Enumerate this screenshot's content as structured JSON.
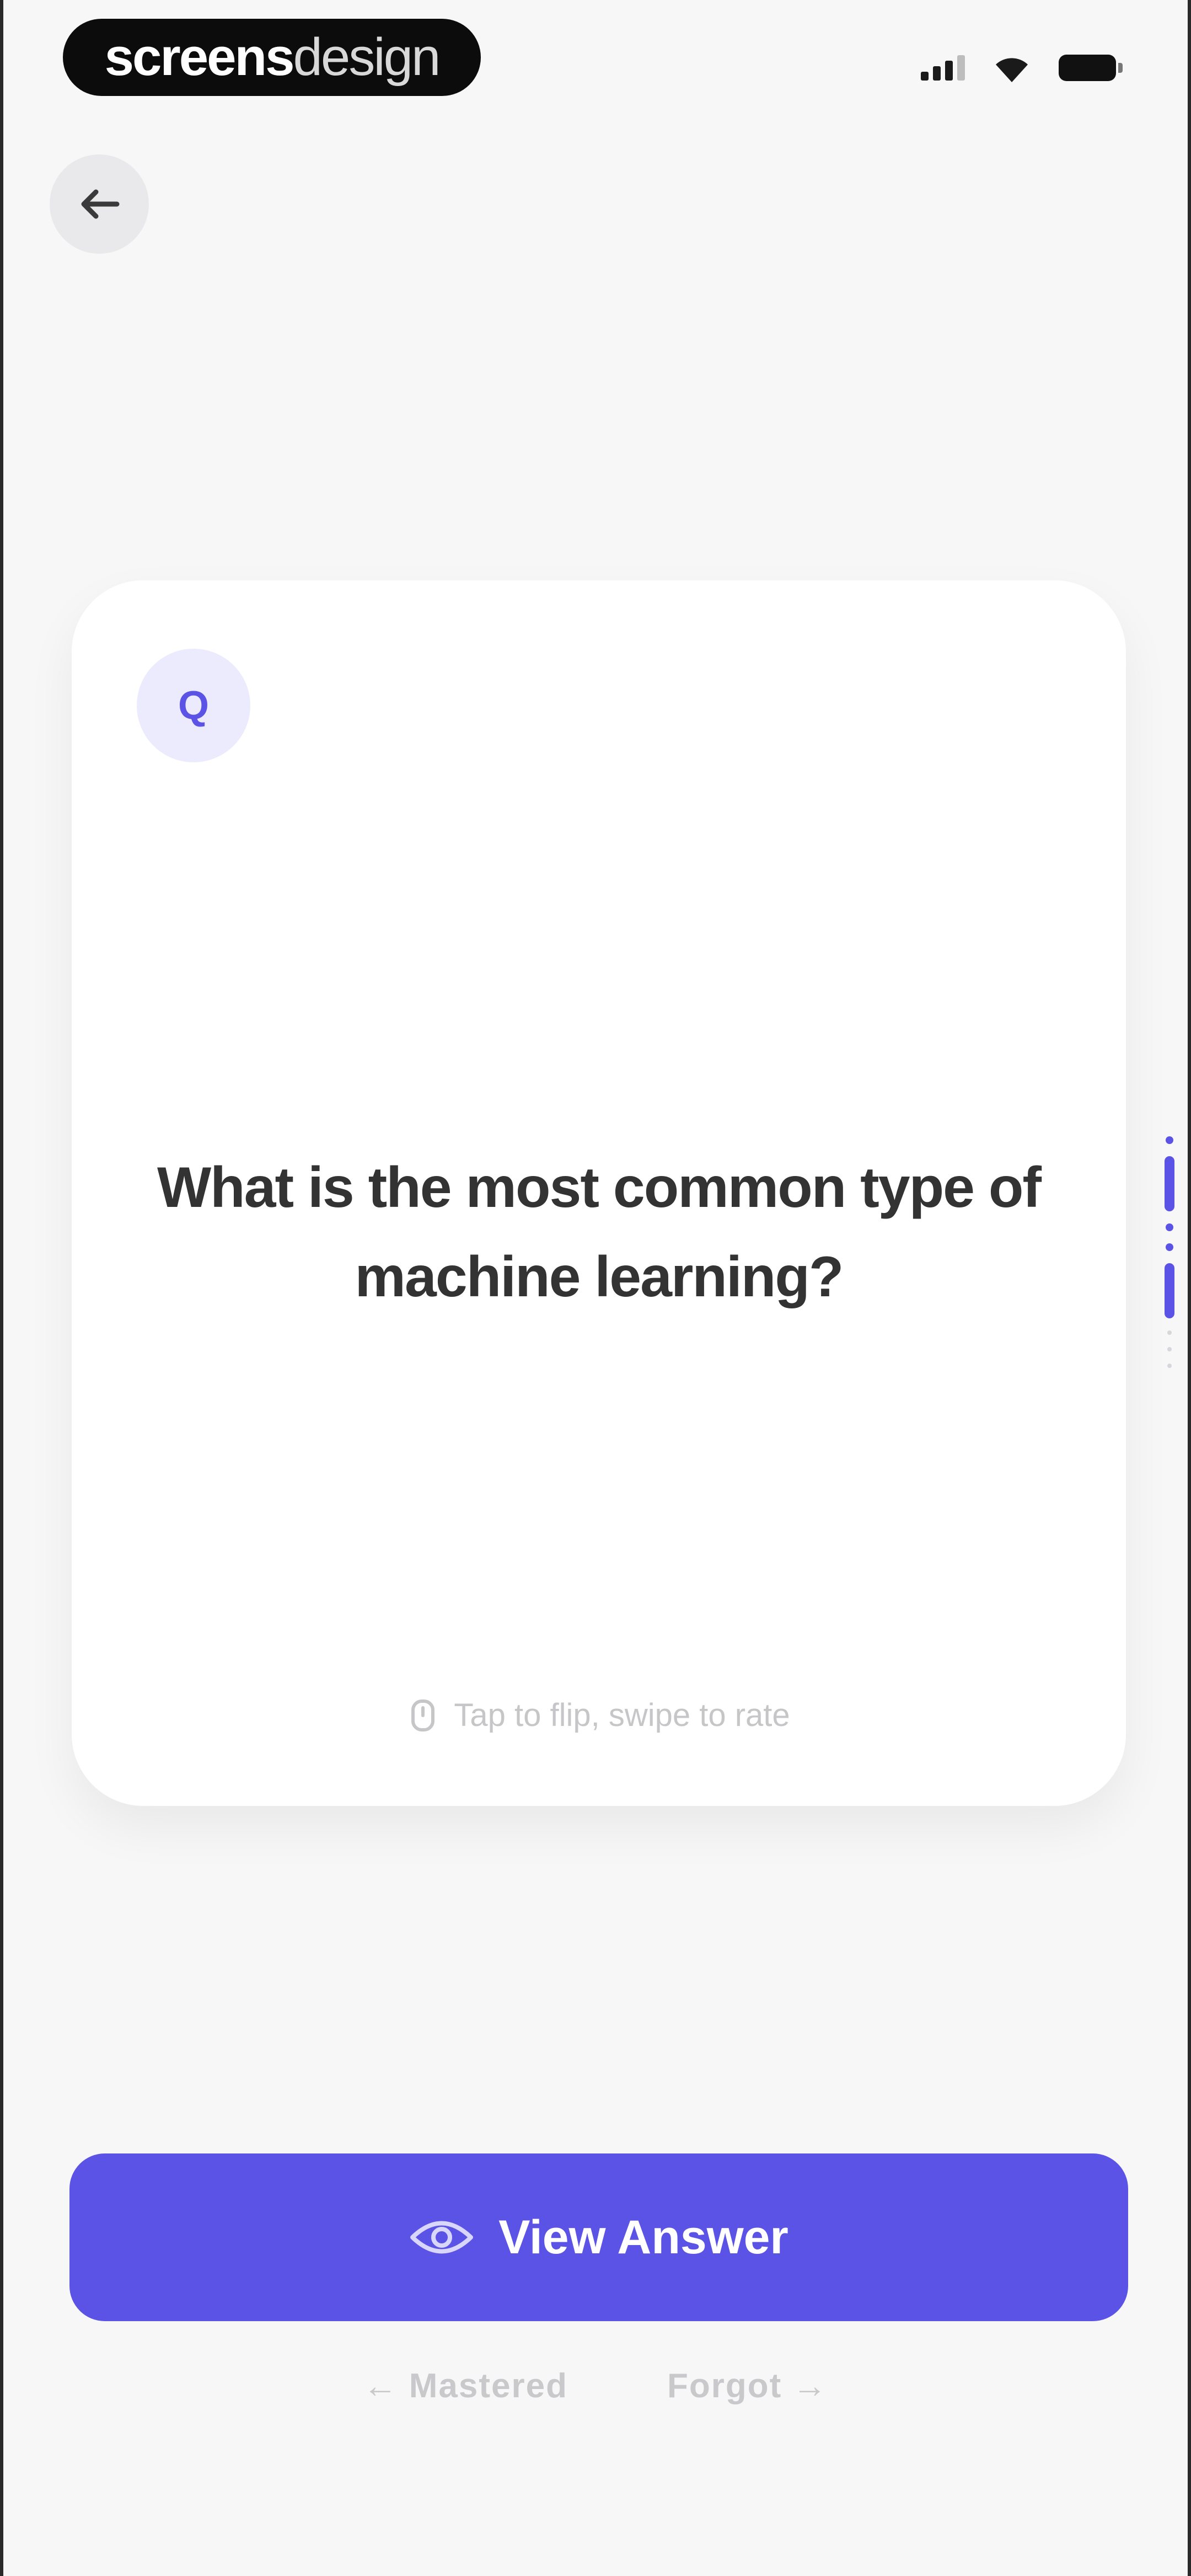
{
  "status_bar": {
    "brand_part1": "screens",
    "brand_part2": "design",
    "signal_icon": "cellular-signal-icon",
    "wifi_icon": "wifi-icon",
    "battery_icon": "battery-icon"
  },
  "nav": {
    "back_icon": "arrow-left-icon"
  },
  "card": {
    "badge_label": "Q",
    "question": "What is the most common type of machine learning?",
    "hint_icon": "hand-tap-icon",
    "hint_text": "Tap to flip, swipe to rate"
  },
  "actions": {
    "view_answer_icon": "eye-icon",
    "view_answer_label": "View Answer",
    "mastered_label": "← Mastered",
    "forgot_label": "Forgot →"
  },
  "colors": {
    "accent": "#5b52e6",
    "background": "#f7f7f8",
    "card": "#ffffff"
  }
}
